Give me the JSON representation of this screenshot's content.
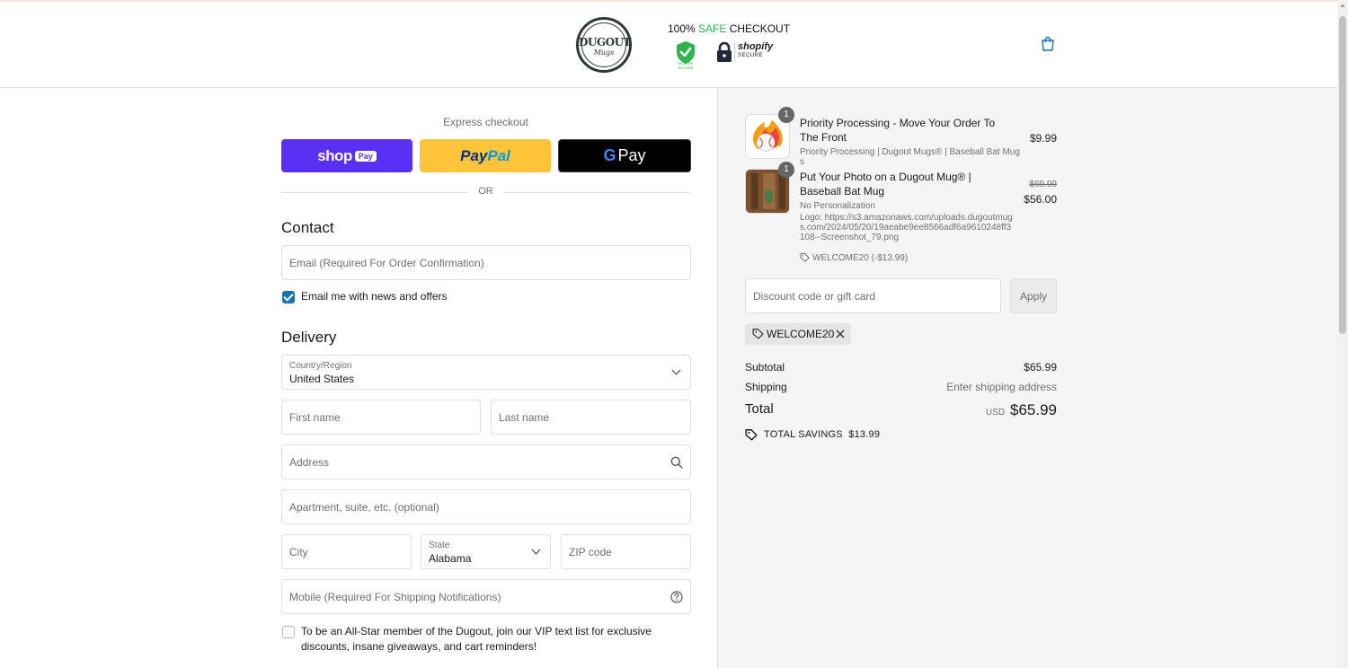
{
  "header": {
    "logo_word": "DUGOUT",
    "logo_sub": "Mugs",
    "safe_prefix": "100% ",
    "safe_highlight": "SAFE",
    "safe_suffix": " CHECKOUT",
    "shield_caption": "MCAFEE SECURE",
    "shopify_title": "shopify",
    "shopify_sub": "SECURE"
  },
  "express": {
    "label": "Express checkout",
    "shoppay_text": "shop",
    "shoppay_pill": "Pay",
    "paypal_a": "Pay",
    "paypal_b": "Pal",
    "gpay_g": "G",
    "gpay_text": "Pay",
    "or": "OR"
  },
  "contact": {
    "title": "Contact",
    "email_placeholder": "Email (Required For Order Confirmation)",
    "news_label": "Email me with news and offers"
  },
  "delivery": {
    "title": "Delivery",
    "country_label": "Country/Region",
    "country_value": "United States",
    "first_name_placeholder": "First name",
    "last_name_placeholder": "Last name",
    "address_placeholder": "Address",
    "apartment_placeholder": "Apartment, suite, etc. (optional)",
    "city_placeholder": "City",
    "state_label": "State",
    "state_value": "Alabama",
    "zip_placeholder": "ZIP code",
    "mobile_placeholder": "Mobile (Required For Shipping Notifications)",
    "vip_label": "To be an All-Star member of the Dugout, join our VIP text list for exclusive discounts, insane giveaways, and cart reminders!"
  },
  "order": {
    "items": [
      {
        "qty": "1",
        "title": "Priority Processing - Move Your Order To The Front",
        "sub": "Priority Processing | Dugout Mugs® | Baseball Bat Mugs",
        "price": "$9.99"
      },
      {
        "qty": "1",
        "title": "Put Your Photo on a Dugout Mug® | Baseball Bat Mug",
        "sub": "No Personalization",
        "logo_line": "Logo: https://s3.amazonaws.com/uploads.dugoutmugs.com/2024/05/20/19aeabe9ee8566adf6a9610248ff3108--Screenshot_79.png",
        "discount": "WELCOME20 (-$13.99)",
        "old_price": "$69.99",
        "price": "$56.00"
      }
    ],
    "discount_placeholder": "Discount code or gift card",
    "apply_label": "Apply",
    "applied_code": "WELCOME20",
    "subtotal_label": "Subtotal",
    "subtotal_value": "$65.99",
    "shipping_label": "Shipping",
    "shipping_value": "Enter shipping address",
    "total_label": "Total",
    "currency": "USD",
    "total_value": "$65.99",
    "savings_label": "TOTAL SAVINGS",
    "savings_value": "$13.99"
  },
  "colors": {
    "accent": "#1773b0",
    "shoppay": "#5a31f4",
    "paypal": "#ffc439",
    "safe_green": "#2fb54c"
  }
}
